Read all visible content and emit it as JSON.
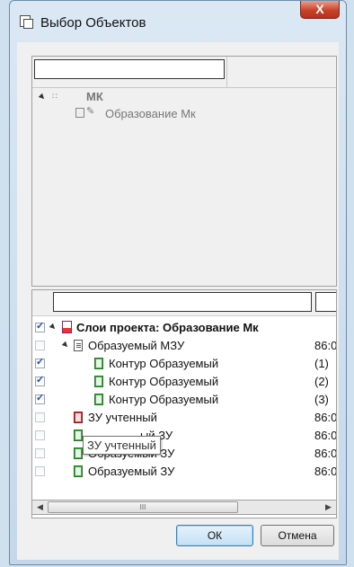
{
  "window": {
    "title": "Выбор Объектов",
    "close_label": "X"
  },
  "upper_tree": {
    "root_label": "МК",
    "child_label": "Образование Мк"
  },
  "lower_tree": {
    "rows": [
      {
        "label": "Слои проекта: Образование Мк",
        "col2": "",
        "checked": true
      },
      {
        "label": "Образуемый МЗУ",
        "col2": "86:0",
        "checked": false
      },
      {
        "label": "Контур Образуемый",
        "col2": "(1)",
        "checked": true
      },
      {
        "label": "Контур Образуемый",
        "col2": "(2)",
        "checked": true
      },
      {
        "label": "Контур Образуемый",
        "col2": "(3)",
        "checked": true
      },
      {
        "label": "ЗУ учтенный",
        "col2": "86:0",
        "checked": false
      },
      {
        "label": "ый ЗУ",
        "col2": "86:0",
        "checked": false
      },
      {
        "label": "Образуемый ЗУ",
        "col2": "86:0",
        "checked": false
      },
      {
        "label": "Образуемый ЗУ",
        "col2": "86:0",
        "checked": false
      }
    ],
    "tooltip": "ЗУ учтенный"
  },
  "scrollbar": {
    "left_arrow": "◀",
    "right_arrow": "▶",
    "thumb_grip": "III"
  },
  "buttons": {
    "ok": "ОК",
    "cancel": "Отмена"
  }
}
